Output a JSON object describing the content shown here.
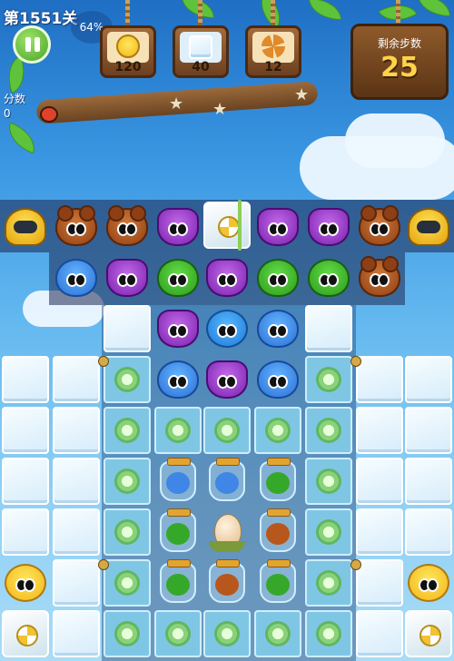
{
  "hud": {
    "level": "第1551关",
    "progress_percent": "64%",
    "score_label": "分数",
    "score_value": "0",
    "moves_title": "剩余步数",
    "moves_value": "25"
  },
  "goals": [
    {
      "target": "chick",
      "count": "120"
    },
    {
      "target": "ice-block",
      "count": "40"
    },
    {
      "target": "flower-tile",
      "count": "12"
    }
  ],
  "board": {
    "row1": [
      "robot",
      "bear",
      "bear",
      "owl",
      "pinwheel-block",
      "owl",
      "owl",
      "bear",
      "robot"
    ],
    "row2": [
      "hippo",
      "owl",
      "frog",
      "owl",
      "frog",
      "frog",
      "bear"
    ],
    "row3": [
      "ice",
      "owl",
      "bird",
      "hippo",
      "ice"
    ],
    "row4": [
      "ice",
      "ice",
      "frost",
      "hippo",
      "owl",
      "hippo",
      "frost",
      "ice",
      "ice"
    ],
    "jars": [
      "blue-jar",
      "blue-jar",
      "green-jar",
      "green-jar",
      "egg",
      "orange-jar",
      "green-jar",
      "orange-jar",
      "green-jar"
    ],
    "corner_pieces": [
      "chick",
      "pinwheel-block"
    ]
  }
}
